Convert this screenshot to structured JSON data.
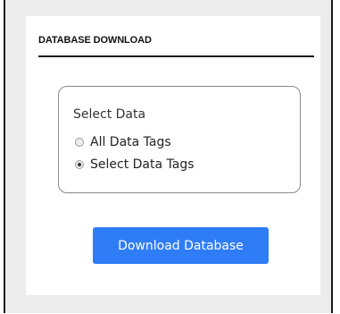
{
  "panel": {
    "title": "DATABASE DOWNLOAD"
  },
  "select_data": {
    "legend": "Select Data",
    "options": [
      {
        "label": "All Data Tags",
        "selected": false
      },
      {
        "label": "Select Data Tags",
        "selected": true
      }
    ]
  },
  "actions": {
    "download_label": "Download Database"
  },
  "colors": {
    "button_background": "#2f7df6",
    "button_text": "#ffffff",
    "outer_background": "#ececec",
    "panel_background": "#ffffff"
  }
}
